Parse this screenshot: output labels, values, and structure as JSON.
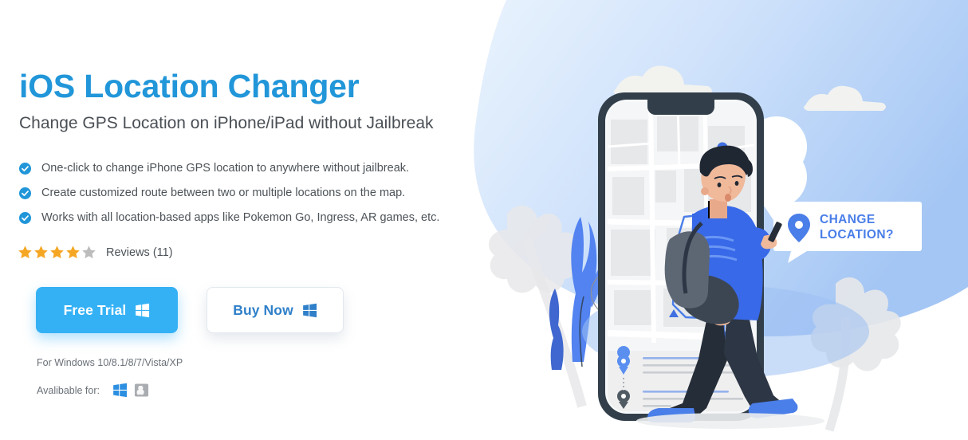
{
  "page": {
    "title": "iOS Location Changer",
    "subtitle": "Change GPS Location on iPhone/iPad without Jailbreak"
  },
  "features": [
    {
      "icon": "check-circle-icon",
      "text": "One-click to change iPhone GPS location to anywhere without jailbreak."
    },
    {
      "icon": "check-circle-icon",
      "text": "Create customized route between two or multiple locations on the map."
    },
    {
      "icon": "check-circle-icon",
      "text": "Works with all location-based apps like Pokemon Go, Ingress, AR games, etc."
    }
  ],
  "rating": {
    "stars_filled": 4,
    "stars_total": 5,
    "reviews_label": "Reviews (11)",
    "filled_color": "#f5a623",
    "empty_color": "#bcbcbc"
  },
  "cta": {
    "free_trial_label": "Free Trial",
    "buy_now_label": "Buy Now",
    "free_trial_icon": "windows-logo-icon",
    "buy_now_icon": "windows-logo-icon"
  },
  "footer": {
    "os_support": "For Windows 10/8.1/8/7/Vista/XP",
    "availability_label": "Avalibable for:",
    "platforms": [
      {
        "name": "windows-logo-icon",
        "color": "#2d8fe0"
      },
      {
        "name": "mac-logo-icon",
        "color": "#a9adb2"
      }
    ]
  },
  "illustration": {
    "callout_line1": "CHANGE",
    "callout_line2": "LOCATION?",
    "callout_icon": "map-pin-icon",
    "callout_text_color": "#4a7ee8",
    "sky_gradient_from": "#e9f3fd",
    "sky_gradient_to": "#a4c6f4",
    "phone_frame_color": "#323f4b",
    "route_color": "#4a7ee8",
    "character": "walking-man-with-phone",
    "map_marker_color": "#3f6fe0"
  },
  "colors": {
    "brand_blue": "#2196d9",
    "cta_blue": "#34b1f5",
    "text_dark": "#4a4f55",
    "text_muted": "#6b7178"
  }
}
